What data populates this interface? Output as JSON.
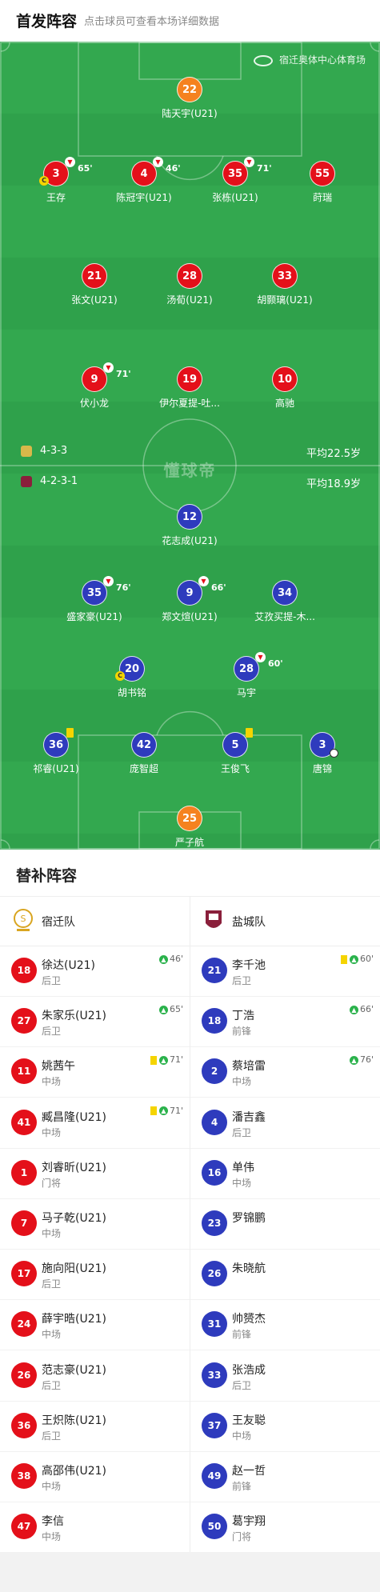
{
  "header": {
    "title": "首发阵容",
    "subtitle": "点击球员可查看本场详细数据"
  },
  "venue": "宿迁奥体中心体育场",
  "watermark": "懂球帝",
  "home_formation": {
    "formation": "4-3-3",
    "avg_age": "平均22.5岁"
  },
  "away_formation": {
    "formation": "4-2-3-1",
    "avg_age": "平均18.9岁"
  },
  "home_players": [
    {
      "num": "22",
      "name": "陆天宇(U21)",
      "color": "orange"
    },
    {
      "num": "3",
      "name": "王存",
      "sub": "65'",
      "captain": true
    },
    {
      "num": "4",
      "name": "陈冠宇(U21)",
      "sub": "46'"
    },
    {
      "num": "35",
      "name": "张栋(U21)",
      "sub": "71'"
    },
    {
      "num": "55",
      "name": "莳瑞"
    },
    {
      "num": "21",
      "name": "张文(U21)"
    },
    {
      "num": "28",
      "name": "汤荀(U21)"
    },
    {
      "num": "33",
      "name": "胡颢璃(U21)"
    },
    {
      "num": "9",
      "name": "伏小龙",
      "sub": "71'"
    },
    {
      "num": "19",
      "name": "伊尔夏提-吐..."
    },
    {
      "num": "10",
      "name": "高驰"
    }
  ],
  "away_players": [
    {
      "num": "12",
      "name": "花志成(U21)"
    },
    {
      "num": "35",
      "name": "盛家豪(U21)",
      "sub": "76'"
    },
    {
      "num": "9",
      "name": "郑文煊(U21)",
      "sub": "66'"
    },
    {
      "num": "34",
      "name": "艾孜买提-木..."
    },
    {
      "num": "20",
      "name": "胡书铭",
      "captain": true
    },
    {
      "num": "28",
      "name": "马宇",
      "sub": "60'"
    },
    {
      "num": "36",
      "name": "祁睿(U21)",
      "yellow": true
    },
    {
      "num": "42",
      "name": "庞智超"
    },
    {
      "num": "5",
      "name": "王俊飞",
      "yellow": true
    },
    {
      "num": "3",
      "name": "唐锦",
      "goal": true
    },
    {
      "num": "25",
      "name": "严子航",
      "color": "orange"
    }
  ],
  "subs_title": "替补阵容",
  "home_team": "宿迁队",
  "away_team": "盐城队",
  "home_subs": [
    {
      "num": "18",
      "name": "徐达(U21)",
      "pos": "后卫",
      "ev": "46'"
    },
    {
      "num": "27",
      "name": "朱家乐(U21)",
      "pos": "后卫",
      "ev": "65'"
    },
    {
      "num": "11",
      "name": "姚茜午",
      "pos": "中场",
      "ev": "71'",
      "yc": true
    },
    {
      "num": "41",
      "name": "臧昌隆(U21)",
      "pos": "中场",
      "ev": "71'",
      "yc": true
    },
    {
      "num": "1",
      "name": "刘睿昕(U21)",
      "pos": "门将"
    },
    {
      "num": "7",
      "name": "马子乾(U21)",
      "pos": "中场"
    },
    {
      "num": "17",
      "name": "施向阳(U21)",
      "pos": "后卫"
    },
    {
      "num": "24",
      "name": "薛宇晧(U21)",
      "pos": "中场"
    },
    {
      "num": "26",
      "name": "范志豪(U21)",
      "pos": "后卫"
    },
    {
      "num": "36",
      "name": "王炽陈(U21)",
      "pos": "后卫"
    },
    {
      "num": "38",
      "name": "高邵伟(U21)",
      "pos": "中场"
    },
    {
      "num": "47",
      "name": "李信",
      "pos": "中场"
    }
  ],
  "away_subs": [
    {
      "num": "21",
      "name": "李千池",
      "pos": "后卫",
      "ev": "60'",
      "yc": true
    },
    {
      "num": "18",
      "name": "丁浩",
      "pos": "前锋",
      "ev": "66'"
    },
    {
      "num": "2",
      "name": "蔡培雷",
      "pos": "中场",
      "ev": "76'"
    },
    {
      "num": "4",
      "name": "潘吉鑫",
      "pos": "后卫"
    },
    {
      "num": "16",
      "name": "单伟",
      "pos": "中场"
    },
    {
      "num": "23",
      "name": "罗锦鹏",
      "pos": ""
    },
    {
      "num": "26",
      "name": "朱晓航",
      "pos": ""
    },
    {
      "num": "31",
      "name": "帅赟杰",
      "pos": "前锋"
    },
    {
      "num": "33",
      "name": "张浩成",
      "pos": "后卫"
    },
    {
      "num": "37",
      "name": "王友聪",
      "pos": "中场"
    },
    {
      "num": "49",
      "name": "赵一哲",
      "pos": "前锋"
    },
    {
      "num": "50",
      "name": "葛宇翔",
      "pos": "门将"
    }
  ]
}
